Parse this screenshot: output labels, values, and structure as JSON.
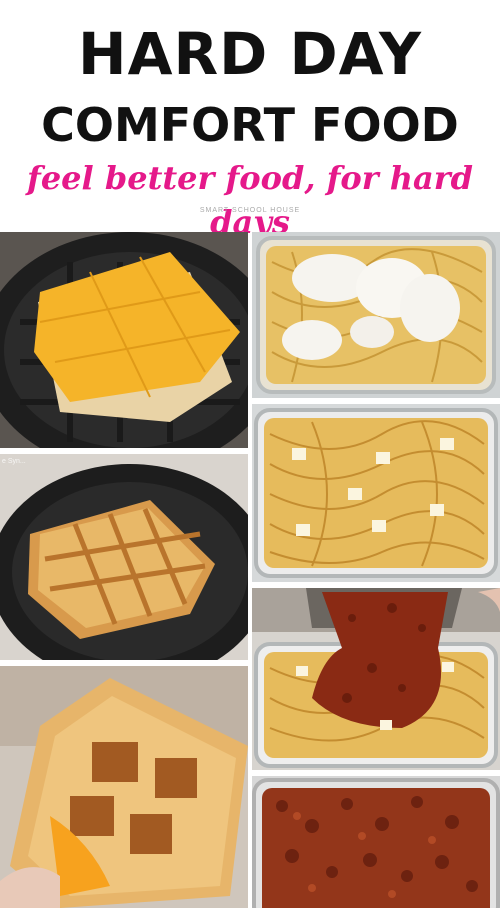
{
  "header": {
    "title_line1": "HARD DAY",
    "title_line2": "COMFORT FOOD",
    "tagline": "feel better food, for hard days",
    "credit": "SMART SCHOOL HOUSE"
  },
  "photos": {
    "left": [
      {
        "name": "cheese-sandwich-on-waffle-iron"
      },
      {
        "name": "waffled-sandwich-on-iron",
        "watermark": "e Syn..."
      },
      {
        "name": "waffled-grilled-cheese-closeup"
      }
    ],
    "right": [
      {
        "name": "spaghetti-with-ricotta"
      },
      {
        "name": "spaghetti-with-butter-cubes"
      },
      {
        "name": "pouring-meat-sauce"
      },
      {
        "name": "baked-meat-sauce-casserole"
      }
    ]
  },
  "colors": {
    "tagline": "#e5198a",
    "title": "#111111",
    "cheese": "#f7b52a",
    "pasta": "#e9c46a",
    "sauce": "#8a2a14"
  }
}
